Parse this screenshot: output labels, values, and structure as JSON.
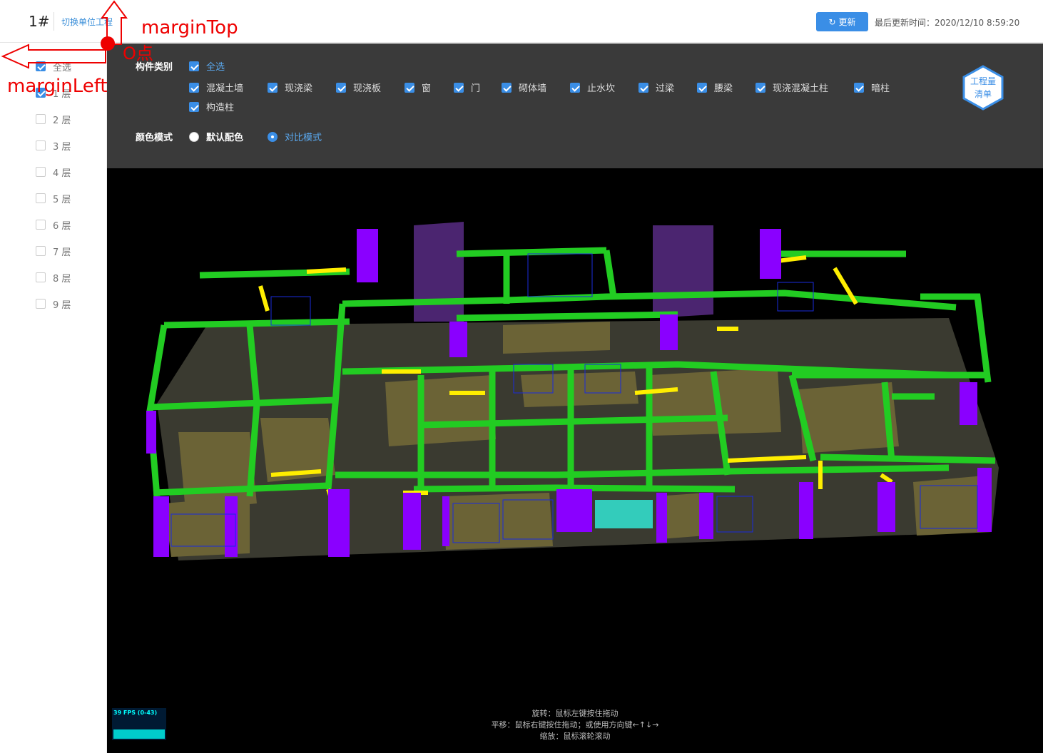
{
  "header": {
    "building": "1#",
    "switch_link": "切换单位工程",
    "refresh_label": "更新",
    "last_updated": "最后更新时间：2020/12/10 8:59:20"
  },
  "sidebar": {
    "items": [
      {
        "label": "全选",
        "checked": true
      },
      {
        "label": "1 层",
        "checked": true
      },
      {
        "label": "2 层",
        "checked": false
      },
      {
        "label": "3 层",
        "checked": false
      },
      {
        "label": "4 层",
        "checked": false
      },
      {
        "label": "5 层",
        "checked": false
      },
      {
        "label": "6 层",
        "checked": false
      },
      {
        "label": "7 层",
        "checked": false
      },
      {
        "label": "8 层",
        "checked": false
      },
      {
        "label": "9 层",
        "checked": false
      }
    ]
  },
  "filter": {
    "category_label": "构件类别",
    "select_all": "全选",
    "categories": [
      "混凝土墙",
      "现浇梁",
      "现浇板",
      "窗",
      "门",
      "砌体墙",
      "止水坎",
      "过梁",
      "腰梁",
      "现浇混凝土柱",
      "暗柱",
      "构造柱"
    ],
    "color_mode_label": "颜色模式",
    "color_modes": [
      {
        "label": "默认配色",
        "selected": false
      },
      {
        "label": "对比模式",
        "selected": true
      }
    ],
    "quantity_button": [
      "工程量",
      "清单"
    ]
  },
  "viewport": {
    "fps": "39 FPS (0-43)",
    "help": [
      "旋转：鼠标左键按住拖动",
      "平移：鼠标右键按住拖动；或使用方向键←↑↓→",
      "缩放：鼠标滚轮滚动"
    ]
  },
  "annotations": {
    "margin_top": "marginTop",
    "margin_left": "marginLeft",
    "origin": "O点"
  },
  "colors": {
    "accent": "#3a8ee6",
    "toolbar_bg": "#3a3a3a",
    "beam_green": "#22cc22",
    "column_purple": "#8a00ff",
    "lintel_yellow": "#ffee00",
    "wall_olive": "#6b6336",
    "annotation_red": "#e00000"
  }
}
